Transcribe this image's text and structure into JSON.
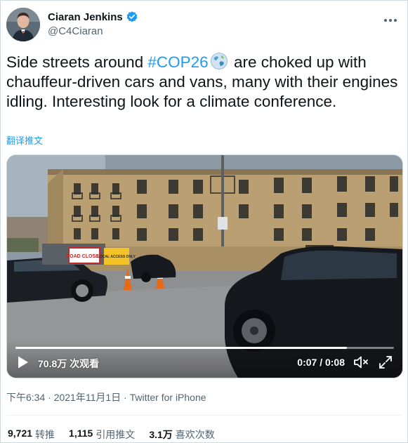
{
  "author": {
    "display_name": "Ciaran Jenkins",
    "handle": "@C4Ciaran",
    "verified": true
  },
  "tweet": {
    "text_before": "Side streets around ",
    "hashtag": "#COP26",
    "text_after": " are choked up with chauffeur-driven cars and vans, many with their engines idling. Interesting look for a climate conference.",
    "translate_label": "翻译推文"
  },
  "video": {
    "views_label": "70.8万 次观看",
    "time_label": "0:07 / 0:08",
    "progress": 0.875,
    "scene_labels": {
      "sign_left": "ROAD CLOSED",
      "sign_right": "LOCAL ACCESS ONLY"
    }
  },
  "meta": {
    "timestamp": "下午6:34 · 2021年11月1日 · Twitter for iPhone"
  },
  "stats": [
    {
      "value": "9,721",
      "label": "转推"
    },
    {
      "value": "1,115",
      "label": "引用推文"
    },
    {
      "value": "3.1万",
      "label": "喜欢次数"
    }
  ],
  "colors": {
    "accent": "#1d9bf0",
    "text": "#0f1419",
    "muted": "#536471"
  },
  "icons": {
    "verified": "verified-badge-icon",
    "more": "more-dots-icon",
    "play": "play-icon",
    "volume": "volume-icon",
    "fullscreen": "fullscreen-icon",
    "globe_emoji": "globe-emoji-icon"
  }
}
